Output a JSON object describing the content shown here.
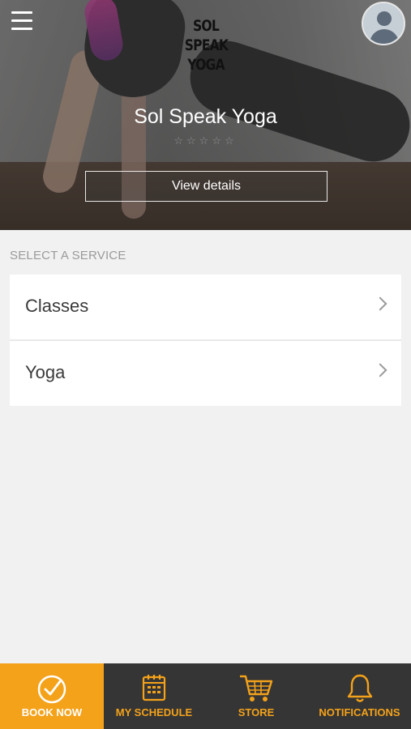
{
  "header": {
    "business_name": "Sol Speak Yoga",
    "logo_lines": [
      "SOL",
      "SPEAK",
      "YOGA"
    ],
    "rating_stars": "☆☆☆☆☆",
    "view_details_label": "View details",
    "menu_icon": "hamburger-icon",
    "avatar_icon": "user-avatar-icon"
  },
  "services": {
    "section_label": "SELECT A SERVICE",
    "items": [
      {
        "label": "Classes"
      },
      {
        "label": "Yoga"
      }
    ]
  },
  "bottom_nav": {
    "items": [
      {
        "label": "BOOK NOW",
        "icon": "check-circle-icon",
        "active": true
      },
      {
        "label": "MY SCHEDULE",
        "icon": "calendar-icon",
        "active": false
      },
      {
        "label": "STORE",
        "icon": "cart-icon",
        "active": false
      },
      {
        "label": "NOTIFICATIONS",
        "icon": "bell-icon",
        "active": false
      }
    ]
  },
  "colors": {
    "accent": "#f4a21a",
    "nav_background": "#353535",
    "page_background": "#f1f1f1"
  }
}
